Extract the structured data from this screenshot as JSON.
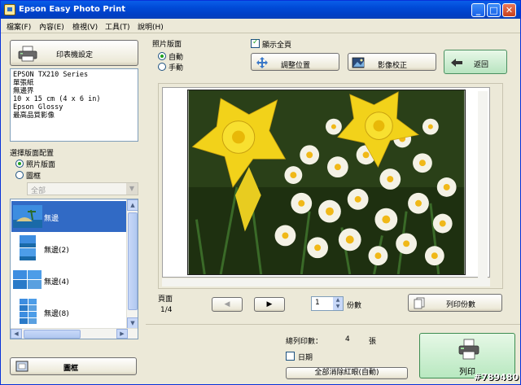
{
  "window": {
    "title": "Epson Easy Photo Print",
    "controls": {
      "minimize": "_",
      "maximize": "□",
      "close": "✕"
    }
  },
  "menu": [
    "檔案(F)",
    "內容(E)",
    "檢視(V)",
    "工具(T)",
    "說明(H)"
  ],
  "left": {
    "printer_settings_label": "印表機設定",
    "printer_info": [
      "EPSON TX210 Series",
      "單張紙",
      "無邊界",
      "10 x 15 cm (4 x 6 in)",
      "Epson Glossy",
      "最高品質影像"
    ],
    "layout_section_label": "選擇版面配置",
    "layout_options": {
      "photo_layout": "照片版面",
      "frame": "圖框"
    },
    "filter_value": "全部",
    "layouts": [
      {
        "label": "無邊"
      },
      {
        "label": "無邊(2)"
      },
      {
        "label": "無邊(4)"
      },
      {
        "label": "無邊(8)"
      }
    ],
    "frame_button_label": "圖框"
  },
  "top": {
    "photo_layout_label": "照片版面",
    "auto_label": "自動",
    "manual_label": "手動",
    "show_full_page_label": "顯示全頁",
    "adjust_position_label": "調整位置",
    "image_correction_label": "影像校正",
    "back_label": "返回"
  },
  "pager": {
    "page_label": "頁面",
    "page_value": "1/4",
    "copies_value": "1",
    "copies_label": "份數",
    "print_copies_label": "列印份數"
  },
  "bottom": {
    "total_prints_label": "總列印數：",
    "total_prints_value": "4",
    "total_prints_unit": "張",
    "date_label": "日期",
    "redeye_label": "全部消除紅眼(自動)",
    "print_label": "列印"
  },
  "watermark": "#789480",
  "colors": {
    "titlebar": "#0049d6",
    "selection": "#316ac5",
    "print_button": "#b8e8c0"
  }
}
